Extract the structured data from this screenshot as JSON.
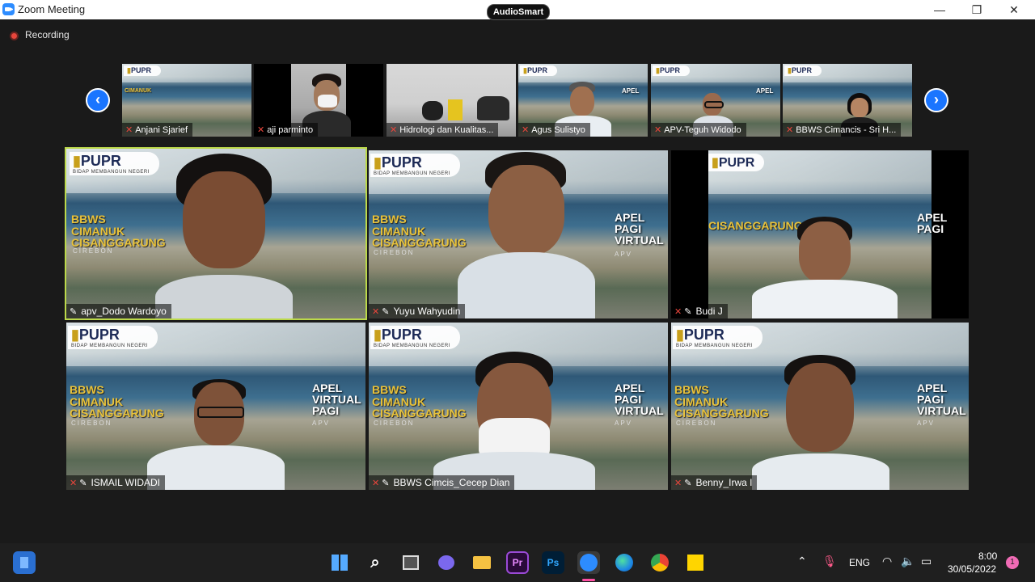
{
  "window": {
    "title": "Zoom Meeting",
    "minimize": "—",
    "maximize": "❐",
    "close": "✕"
  },
  "audio_pill": "AudioSmart",
  "recording_label": "Recording",
  "nav": {
    "prev": "‹",
    "next": "›"
  },
  "thumbnails": [
    {
      "name": "Anjani Sjarief"
    },
    {
      "name": "aji parminto"
    },
    {
      "name": "Hidrologi dan Kualitas..."
    },
    {
      "name": "Agus Sulistyo"
    },
    {
      "name": "APV-Teguh Widodo"
    },
    {
      "name": "BBWS Cimancis - Sri H..."
    }
  ],
  "background": {
    "logo": "PUPR",
    "logo_tag": "BIDAP MEMBANGUN NEGERI",
    "bbws_line1": "BBWS",
    "bbws_line2": "CIMANUK",
    "bbws_line3": "CISANGGARUNG",
    "city": "CIREBON",
    "apel_1": "APEL",
    "apel_2": "PAGI",
    "apel_3": "VIRTUAL",
    "apv": "APV"
  },
  "tiles": [
    {
      "name": "apv_Dodo Wardoyo",
      "active": true,
      "mic_muted": false
    },
    {
      "name": "Yuyu Wahyudin",
      "mic_muted": true
    },
    {
      "name": "Budi J",
      "mic_muted": true
    },
    {
      "name": "ISMAIL WIDADI",
      "mic_muted": true
    },
    {
      "name": "BBWS Cimcis_Cecep Dian",
      "mic_muted": true
    },
    {
      "name": "Benny_Irwa I",
      "mic_muted": true
    }
  ],
  "taskbar": {
    "language": "ENG",
    "time": "8:00",
    "date": "30/05/2022",
    "notifications": "1",
    "apps": [
      "widgets",
      "start",
      "search",
      "task-view",
      "chat",
      "file-explorer",
      "premiere",
      "photoshop",
      "zoom",
      "edge",
      "chrome",
      "sticky-notes"
    ]
  },
  "colors": {
    "accent_blue": "#1a75ff",
    "active_speaker": "#bcd94a",
    "muted_red": "#e8463c"
  }
}
